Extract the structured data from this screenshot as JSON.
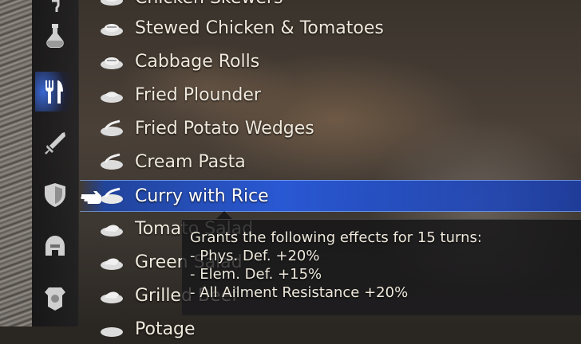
{
  "sidebar": {
    "items": [
      {
        "icon": "potion-icon",
        "active": false
      },
      {
        "icon": "fork-knife-icon",
        "active": true
      },
      {
        "icon": "sword-icon",
        "active": false
      },
      {
        "icon": "shield-icon",
        "active": false
      },
      {
        "icon": "helmet-icon",
        "active": false
      },
      {
        "icon": "armor-icon",
        "active": false
      }
    ]
  },
  "recipes": {
    "items": [
      {
        "label": "Chicken Skewers"
      },
      {
        "label": "Stewed Chicken & Tomatoes"
      },
      {
        "label": "Cabbage Rolls"
      },
      {
        "label": "Fried Plounder"
      },
      {
        "label": "Fried Potato Wedges"
      },
      {
        "label": "Cream Pasta"
      },
      {
        "label": "Curry with Rice"
      },
      {
        "label": "Tomato Salad"
      },
      {
        "label": "Green Salad"
      },
      {
        "label": "Grilled Beef"
      },
      {
        "label": "Potage"
      }
    ],
    "selected": "Curry with Rice"
  },
  "tooltip": {
    "header": "Grants the following effects for 15 turns:",
    "effects": [
      "- Phys. Def. +20%",
      "- Elem. Def. +15%",
      "- All Ailment Resistance +20%"
    ]
  },
  "colors": {
    "selection": "#2f5fd6",
    "text": "#efe9dc"
  }
}
